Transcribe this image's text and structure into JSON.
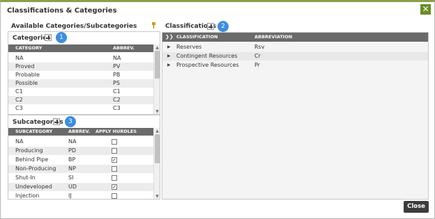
{
  "dialog": {
    "title": "Classifications & Categories",
    "close_x": "✕",
    "close_label": "Close"
  },
  "left": {
    "header": "Available Categories/Subcategories",
    "categories": {
      "title": "Categories",
      "badge": "1",
      "columns": [
        "CATEGORY",
        "ABBREV."
      ],
      "rows": [
        {
          "name": "NA",
          "abbrev": "NA"
        },
        {
          "name": "Proved",
          "abbrev": "PV"
        },
        {
          "name": "Probable",
          "abbrev": "PB"
        },
        {
          "name": "Possible",
          "abbrev": "PS"
        },
        {
          "name": "C1",
          "abbrev": "C1"
        },
        {
          "name": "C2",
          "abbrev": "C2"
        },
        {
          "name": "C3",
          "abbrev": "C3"
        }
      ]
    },
    "subcategories": {
      "title": "Subcategories",
      "badge": "3",
      "columns": [
        "SUBCATEGORY",
        "ABBREV.",
        "APPLY HURDLES"
      ],
      "rows": [
        {
          "name": "NA",
          "abbrev": "NA",
          "hurdles": false
        },
        {
          "name": "Producing",
          "abbrev": "PD",
          "hurdles": false
        },
        {
          "name": "Behind Pipe",
          "abbrev": "BP",
          "hurdles": true
        },
        {
          "name": "Non-Producing",
          "abbrev": "NP",
          "hurdles": false
        },
        {
          "name": "Shut-In",
          "abbrev": "SI",
          "hurdles": false
        },
        {
          "name": "Undeveloped",
          "abbrev": "UD",
          "hurdles": true
        },
        {
          "name": "Injection",
          "abbrev": "IJ",
          "hurdles": false
        }
      ]
    }
  },
  "right": {
    "title": "Classifications",
    "badge": "2",
    "expand_all": "❯❯",
    "columns": [
      "CLASSIFICATION",
      "ABBREVIATION"
    ],
    "rows": [
      {
        "name": "Reserves",
        "abbrev": "Rsv"
      },
      {
        "name": "Contingent Resources",
        "abbrev": "Cr"
      },
      {
        "name": "Prospective Resources",
        "abbrev": "Pr"
      }
    ]
  },
  "colors": {
    "accent": "#6b8e23",
    "badge": "#3d8ee0",
    "header_bg": "#6a6a6a"
  }
}
